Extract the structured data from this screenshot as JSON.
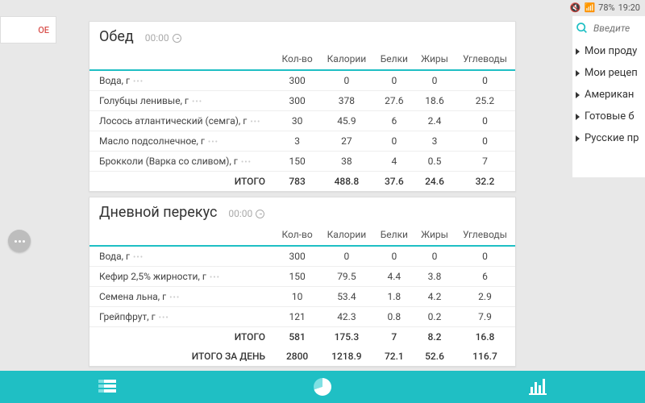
{
  "status": {
    "mute": "🔇",
    "wifi": "📶",
    "battery": "78%",
    "time": "19:20"
  },
  "tab_fragment": "ОЕ",
  "search_placeholder": "Введите",
  "categories": [
    "Мои проду",
    "Мои рецеп",
    "Американ",
    "Готовые б",
    "Русские пр"
  ],
  "cols": [
    "Кол-во",
    "Калории",
    "Белки",
    "Жиры",
    "Углеводы"
  ],
  "meals": [
    {
      "title": "Обед",
      "time": "00:00",
      "rows": [
        {
          "name": "Вода, г",
          "v": [
            "300",
            "0",
            "0",
            "0",
            "0"
          ]
        },
        {
          "name": "Голубцы ленивые, г",
          "v": [
            "300",
            "378",
            "27.6",
            "18.6",
            "25.2"
          ]
        },
        {
          "name": "Лосось атлантический (семга), г",
          "v": [
            "30",
            "45.9",
            "6",
            "2.4",
            "0"
          ]
        },
        {
          "name": "Масло подсолнечное, г",
          "v": [
            "3",
            "27",
            "0",
            "3",
            "0"
          ]
        },
        {
          "name": "Брокколи (Варка со сливом), г",
          "v": [
            "150",
            "38",
            "4",
            "0.5",
            "7"
          ]
        }
      ],
      "totals": [
        {
          "label": "ИТОГО",
          "v": [
            "783",
            "488.8",
            "37.6",
            "24.6",
            "32.2"
          ]
        }
      ]
    },
    {
      "title": "Дневной перекус",
      "time": "00:00",
      "rows": [
        {
          "name": "Вода, г",
          "v": [
            "300",
            "0",
            "0",
            "0",
            "0"
          ]
        },
        {
          "name": "Кефир 2,5% жирности, г",
          "v": [
            "150",
            "79.5",
            "4.4",
            "3.8",
            "6"
          ]
        },
        {
          "name": "Семена льна, г",
          "v": [
            "10",
            "53.4",
            "1.8",
            "4.2",
            "2.9"
          ]
        },
        {
          "name": "Грейпфрут, г",
          "v": [
            "121",
            "42.3",
            "0.8",
            "0.2",
            "7.9"
          ]
        }
      ],
      "totals": [
        {
          "label": "ИТОГО",
          "v": [
            "581",
            "175.3",
            "7",
            "8.2",
            "16.8"
          ]
        },
        {
          "label": "ИТОГО ЗА ДЕНЬ",
          "v": [
            "2800",
            "1218.9",
            "72.1",
            "52.6",
            "116.7"
          ]
        }
      ]
    }
  ]
}
